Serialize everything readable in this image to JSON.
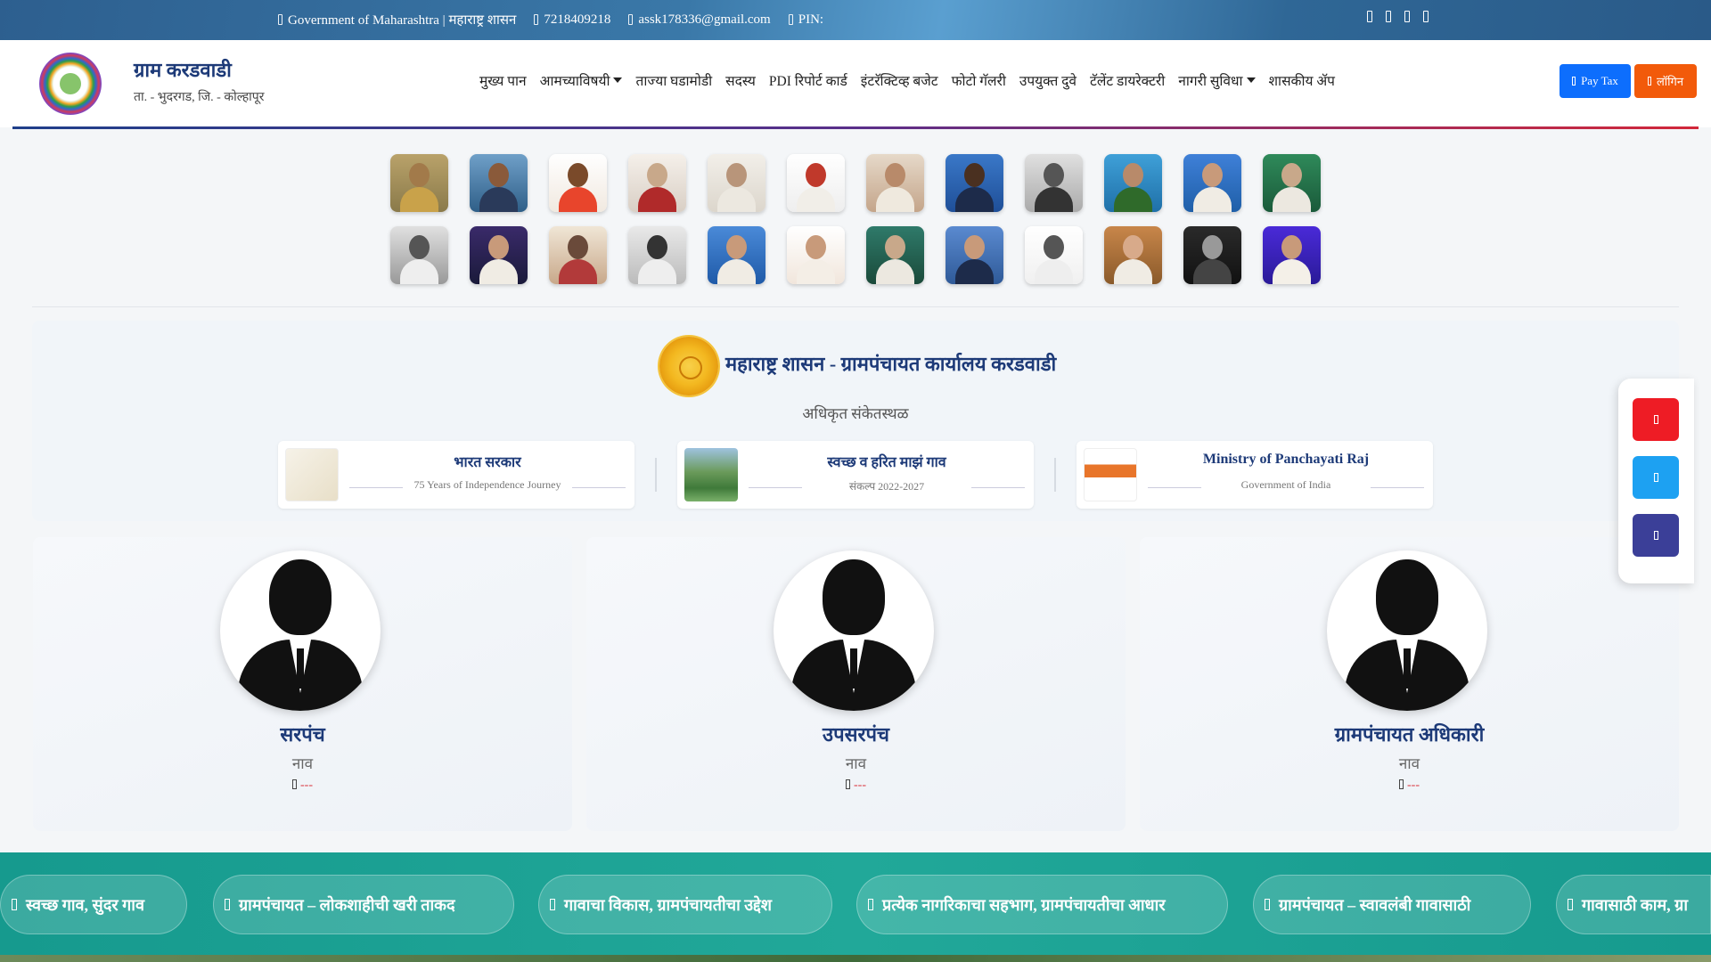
{
  "topbar": {
    "government": "Government of Maharashtra | महाराष्ट्र शासन",
    "phone": "7218409218",
    "email": "assk178336@gmail.com",
    "pin": "PIN:"
  },
  "header": {
    "village_name": "ग्राम करडवाडी",
    "location": "ता. - भुदरगड, जि. - कोल्हापूर",
    "nav": [
      {
        "label": "मुख्य पान",
        "dropdown": false
      },
      {
        "label": "आमच्याविषयी",
        "dropdown": true
      },
      {
        "label": "ताज्या घडामोडी",
        "dropdown": false
      },
      {
        "label": "सदस्य",
        "dropdown": false
      },
      {
        "label": "PDI रिपोर्ट कार्ड",
        "dropdown": false
      },
      {
        "label": "इंटरॅक्टिव्ह बजेट",
        "dropdown": false
      },
      {
        "label": "फोटो गॅलरी",
        "dropdown": false
      },
      {
        "label": "उपयुक्त दुवे",
        "dropdown": false
      },
      {
        "label": "टॅलेंट डायरेक्टरी",
        "dropdown": false
      },
      {
        "label": "नागरी सुविधा",
        "dropdown": true
      },
      {
        "label": "शासकीय ॲप",
        "dropdown": false
      }
    ],
    "pay_tax": "Pay Tax",
    "login": "लॉगिन"
  },
  "official": {
    "title": "महाराष्ट्र शासन - ग्रामपंचायत कार्यालय करडवाडी",
    "subtitle": "अधिकृत संकेतस्थळ",
    "cards": [
      {
        "title": "भारत सरकार",
        "sub": "75 Years of Independence Journey"
      },
      {
        "title": "स्वच्छ व हरित माझं गाव",
        "sub": "संकल्प 2022-2027"
      },
      {
        "title": "Ministry of Panchayati Raj",
        "sub": "Government of India"
      }
    ]
  },
  "officers": [
    {
      "role": "सरपंच",
      "name": "नाव",
      "phone": "---"
    },
    {
      "role": "उपसरपंच",
      "name": "नाव",
      "phone": "---"
    },
    {
      "role": "ग्रामपंचायत अधिकारी",
      "name": "नाव",
      "phone": "---"
    }
  ],
  "ticker": [
    "स्वच्छ गाव, सुंदर गाव",
    "ग्रामपंचायत – लोकशाहीची खरी ताकद",
    "गावाचा विकास, ग्रामपंचायतीचा उद्देश",
    "प्रत्येक नागरिकाचा सहभाग, ग्रामपंचायतीचा आधार",
    "ग्रामपंचायत – स्वावलंबी गावासाठी",
    "गावासाठी काम, ग्रा"
  ],
  "colors": {
    "primary": "#1d3a78",
    "pay_tax": "#0d6efd",
    "login": "#f25a0a",
    "ticker": "#1aa091",
    "youtube": "#ee1c25",
    "twitter": "#1da1f2",
    "facebook": "#3b3f98"
  },
  "icons": {
    "topbar": [
      "building-icon",
      "phone-icon",
      "email-icon",
      "map-pin-icon"
    ],
    "social": [
      "facebook-icon",
      "twitter-icon",
      "instagram-icon",
      "youtube-icon"
    ]
  }
}
